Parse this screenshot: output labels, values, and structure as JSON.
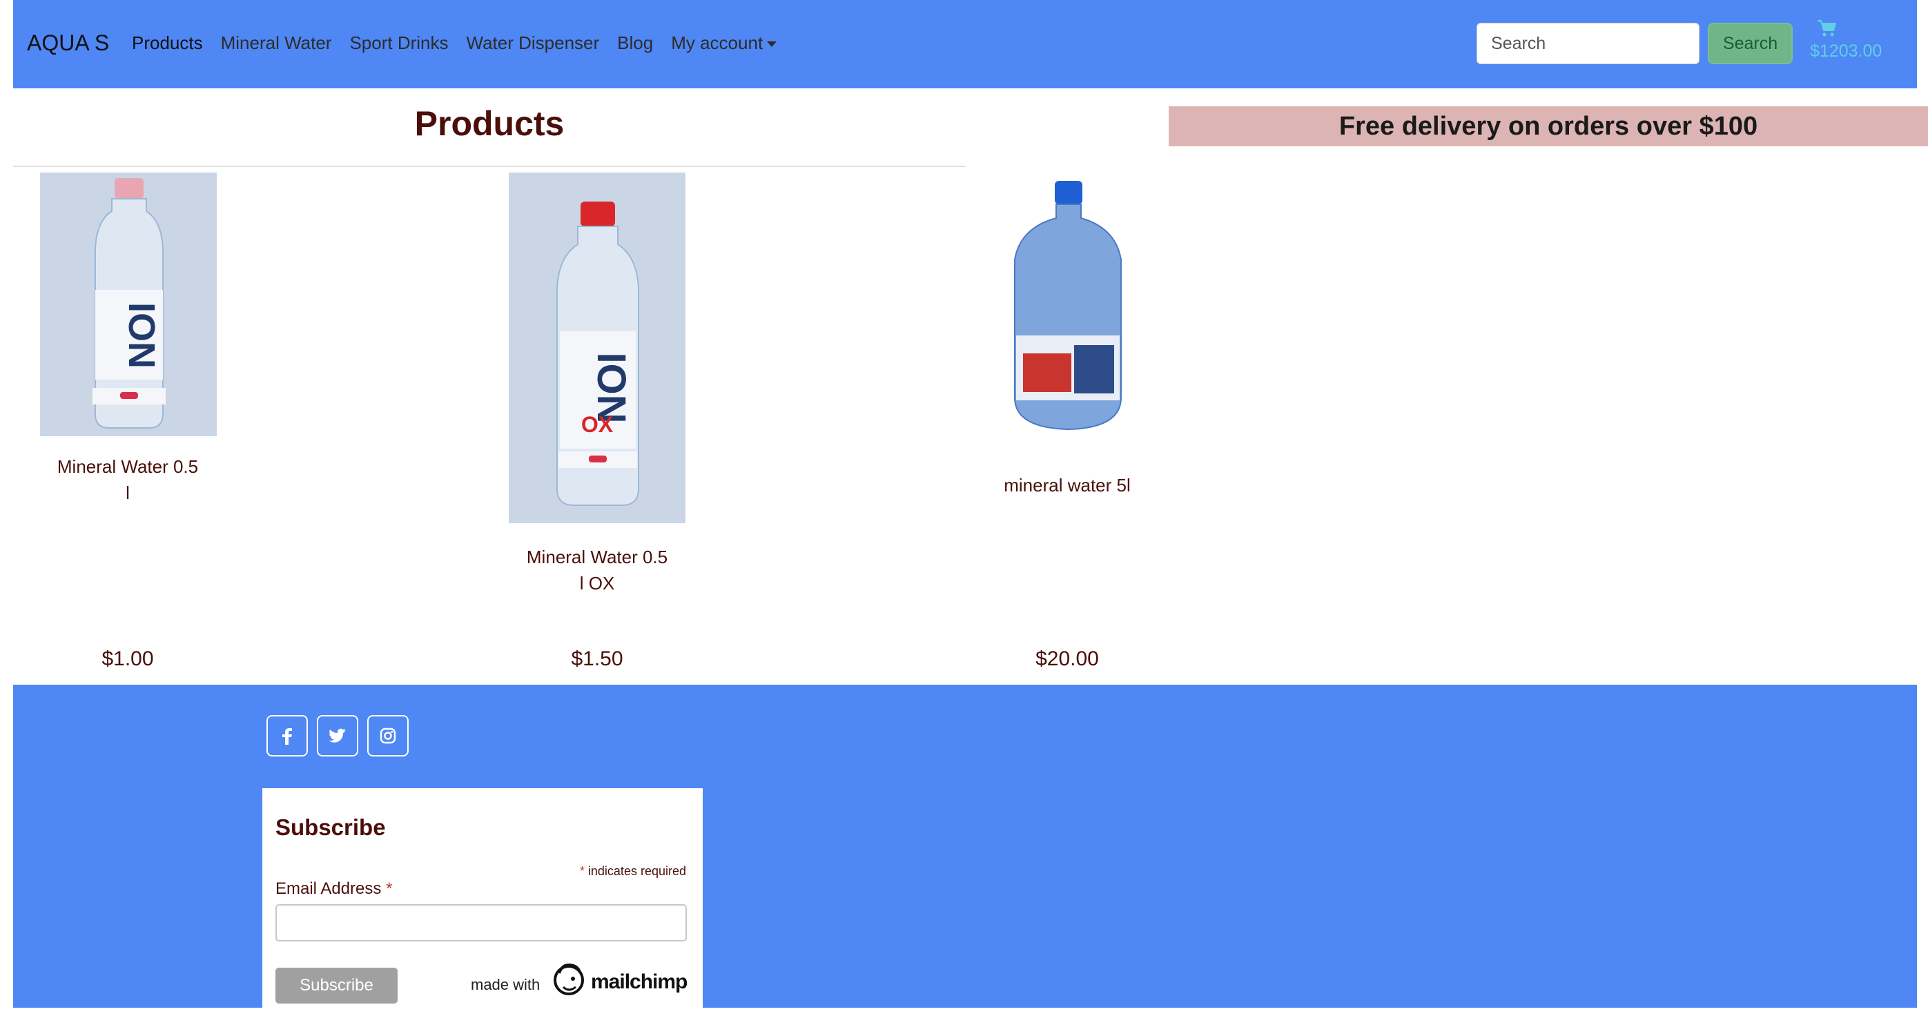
{
  "navbar": {
    "brand": "AQUA S",
    "links": [
      {
        "label": "Products",
        "active": true
      },
      {
        "label": "Mineral Water"
      },
      {
        "label": "Sport Drinks"
      },
      {
        "label": "Water Dispenser"
      },
      {
        "label": "Blog"
      },
      {
        "label": "My account"
      }
    ],
    "search_placeholder": "Search",
    "search_button": "Search",
    "cart_icon": "shopping-cart-icon",
    "cart_total": "$1203.00",
    "background_color": "#4f87f4"
  },
  "main": {
    "title": "Products",
    "promo_banner": "Free delivery on orders over $100",
    "products": [
      {
        "name": "Mineral Water 0.5 l",
        "price": "$1.00"
      },
      {
        "name": "Mineral Water 0.5 l OX",
        "price": "$1.50"
      },
      {
        "name": "mineral water 5l",
        "price": "$20.00"
      }
    ]
  },
  "footer": {
    "social": [
      {
        "icon": "facebook-icon"
      },
      {
        "icon": "twitter-icon"
      },
      {
        "icon": "instagram-icon"
      }
    ],
    "subscribe": {
      "title": "Subscribe",
      "required_note": "indicates required",
      "asterisk": "*",
      "email_label": "Email Address",
      "button": "Subscribe",
      "made_with": "made with",
      "brand": "mailchimp"
    }
  }
}
